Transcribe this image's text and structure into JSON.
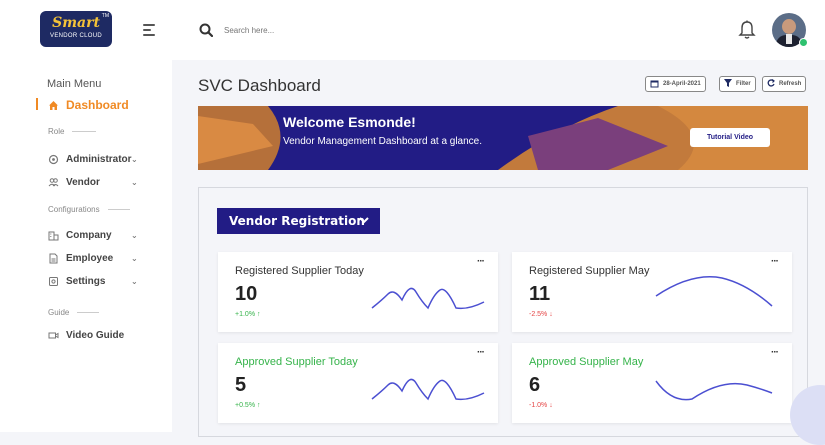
{
  "brand": {
    "name": "Smart",
    "sub": "VENDOR CLOUD",
    "tm": "TM"
  },
  "search": {
    "placeholder": "Search here..."
  },
  "sidebar": {
    "heading": "Main Menu",
    "items": [
      {
        "label": "Dashboard",
        "icon": "home-icon",
        "active": true
      },
      {
        "label": "Administrator",
        "icon": "admin-icon"
      },
      {
        "label": "Vendor",
        "icon": "vendor-icon"
      },
      {
        "label": "Company",
        "icon": "company-icon"
      },
      {
        "label": "Employee",
        "icon": "employee-icon"
      },
      {
        "label": "Settings",
        "icon": "settings-icon"
      },
      {
        "label": "Video Guide",
        "icon": "video-icon"
      }
    ],
    "sections": {
      "role": "Role",
      "configurations": "Configurations",
      "guide": "Guide"
    }
  },
  "page": {
    "title": "SVC Dashboard"
  },
  "toolbar": {
    "date": "28-April-2021",
    "filter": "Filter",
    "refresh": "Refresh"
  },
  "banner": {
    "title": "Welcome Esmonde!",
    "subtitle": "Vendor Management Dashboard at a glance.",
    "button": "Tutorial Video"
  },
  "panel": {
    "dropdown": "Vendor Registration"
  },
  "cards": [
    {
      "title": "Registered Supplier Today",
      "value": "10",
      "change": "+1.0%",
      "trend": "up",
      "title_color": "#333333"
    },
    {
      "title": "Registered Supplier May",
      "value": "11",
      "change": "-2.5%",
      "trend": "down",
      "title_color": "#333333"
    },
    {
      "title": "Approved Supplier Today",
      "value": "5",
      "change": "+0.5%",
      "trend": "up",
      "title_color": "#35b34a"
    },
    {
      "title": "Approved Supplier May",
      "value": "6",
      "change": "-1.0%",
      "trend": "down",
      "title_color": "#35b34a"
    }
  ],
  "colors": {
    "accent": "#f08a24",
    "brand": "#221c85",
    "up": "#35b34a",
    "down": "#e54646",
    "sparkline": "#4b4fd1"
  }
}
